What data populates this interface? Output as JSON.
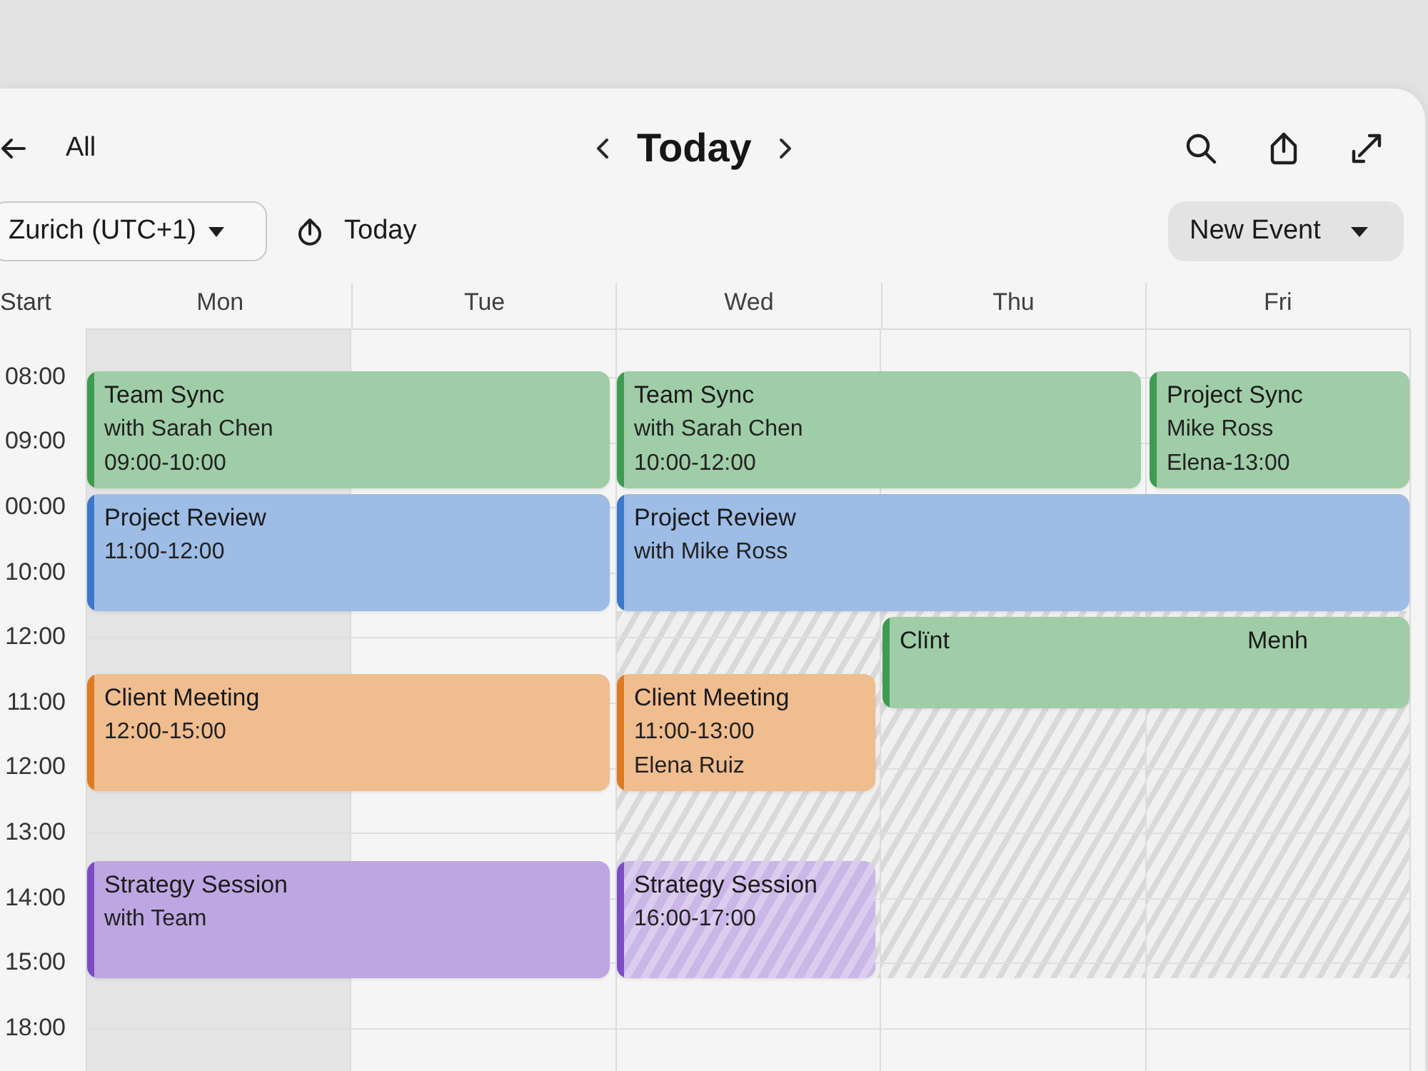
{
  "toolbar": {
    "back_label": "All",
    "title": "Today"
  },
  "controls": {
    "timezone": "Zurich (UTC+1)",
    "today_label": "Today",
    "new_event_label": "New Event"
  },
  "calendar": {
    "corner_label": "Start",
    "days": [
      {
        "label": "Mon",
        "highlighted": true,
        "blocked": false
      },
      {
        "label": "Tue",
        "highlighted": false,
        "blocked": false
      },
      {
        "label": "Wed",
        "highlighted": false,
        "blocked": true
      },
      {
        "label": "Thu",
        "highlighted": false,
        "blocked": true
      },
      {
        "label": "Fri",
        "highlighted": false,
        "blocked": true
      }
    ],
    "times": [
      "08:00",
      "09:00",
      "00:00",
      "10:00",
      "12:00",
      "11:00",
      "12:00",
      "13:00",
      "14:00",
      "15:00",
      "18:00"
    ],
    "events": [
      {
        "title": "Team Sync",
        "lines": [
          "with Sarah Chen",
          "09:00-10:00"
        ],
        "color": "#3f9b4f",
        "tentative": false
      },
      {
        "title": "Team Sync",
        "lines": [
          "with Sarah Chen",
          "10:00-12:00"
        ],
        "color": "#3f9b4f",
        "tentative": false
      },
      {
        "title": "Project Sync",
        "lines": [
          "Mike Ross",
          "Elena-13:00"
        ],
        "color": "#3f9b4f",
        "tentative": false
      },
      {
        "title": "Project Review",
        "lines": [
          "11:00-12:00"
        ],
        "color": "#3b78cc",
        "tentative": false
      },
      {
        "title": "Project Review",
        "lines": [
          "with Mike Ross"
        ],
        "color": "#3b78cc",
        "tentative": false
      },
      {
        "title": "Clïnt",
        "side_text": "Menh",
        "color": "#3f9b4f",
        "tentative": false
      },
      {
        "title": "Client Meeting",
        "lines": [
          "12:00-15:00"
        ],
        "color": "#e07a1f",
        "tentative": false
      },
      {
        "title": "Client Meeting",
        "lines": [
          "11:00-13:00",
          "Elena Ruiz"
        ],
        "color": "#e07a1f",
        "tentative": false
      },
      {
        "title": "Strategy Session",
        "lines": [
          "with Team"
        ],
        "color": "#7c4cc4",
        "tentative": false
      },
      {
        "title": "Strategy Session",
        "lines": [
          "16:00-17:00"
        ],
        "color": "#7c4cc4",
        "tentative": true
      }
    ]
  }
}
